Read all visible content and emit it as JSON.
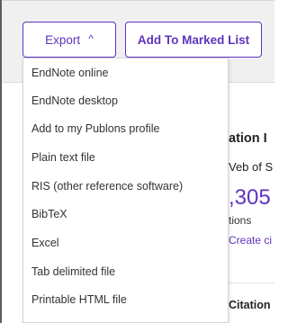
{
  "toolbar": {
    "export_label": "Export",
    "export_chevron": "^",
    "add_marked_label": "Add To Marked List"
  },
  "export_menu": {
    "items": [
      {
        "label": "EndNote online"
      },
      {
        "label": "EndNote desktop"
      },
      {
        "label": "Add to my Publons profile"
      },
      {
        "label": "Plain text file"
      },
      {
        "label": "RIS (other reference software)"
      },
      {
        "label": "BibTeX"
      },
      {
        "label": "Excel"
      },
      {
        "label": "Tab delimited file"
      },
      {
        "label": "Printable HTML file"
      }
    ]
  },
  "background": {
    "heading_partial": "ation I",
    "subheading_partial": "Veb of S",
    "count_partial": ",305",
    "count_label_partial": "tions",
    "link_partial": "Create ci",
    "section_partial": "Citation"
  },
  "colors": {
    "accent": "#5e33bf",
    "toolbar_bg": "#f0f0f0",
    "text": "#333333"
  }
}
